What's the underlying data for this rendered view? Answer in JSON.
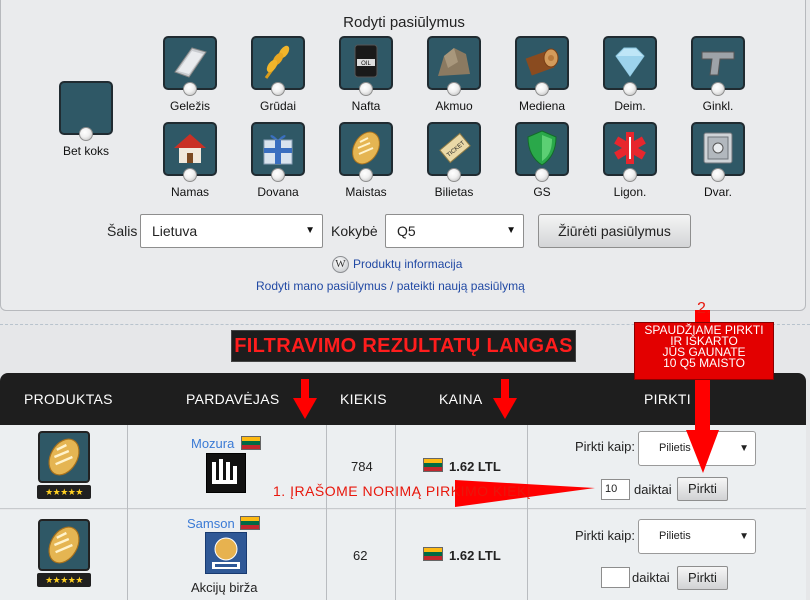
{
  "filter": {
    "title": "Rodyti pasiūlymus",
    "any_label": "Bet koks",
    "products": [
      {
        "label": "Geležis",
        "icon": "iron-bar-icon"
      },
      {
        "label": "Grūdai",
        "icon": "grain-icon"
      },
      {
        "label": "Nafta",
        "icon": "oil-barrel-icon"
      },
      {
        "label": "Akmuo",
        "icon": "stone-icon"
      },
      {
        "label": "Mediena",
        "icon": "wood-log-icon"
      },
      {
        "label": "Deim.",
        "icon": "diamond-icon"
      },
      {
        "label": "Ginkl.",
        "icon": "pistol-icon"
      },
      {
        "label": "Namas",
        "icon": "house-icon"
      },
      {
        "label": "Dovana",
        "icon": "gift-icon"
      },
      {
        "label": "Maistas",
        "icon": "bread-icon"
      },
      {
        "label": "Bilietas",
        "icon": "ticket-icon"
      },
      {
        "label": "GS",
        "icon": "shield-icon"
      },
      {
        "label": "Ligon.",
        "icon": "medical-cross-icon"
      },
      {
        "label": "Dvar.",
        "icon": "safe-icon"
      }
    ],
    "country_label": "Šalis",
    "country_value": "Lietuva",
    "quality_label": "Kokybė",
    "quality_value": "Q5",
    "view_button": "Žiūrėti pasiūlymus",
    "info_link": "Produktų informacija",
    "my_offers_link": "Rodyti mano pasiūlymus / pateikti naują pasiūlymą"
  },
  "results_banner": "FILTRAVIMO REZULTATŲ LANGAS",
  "table": {
    "headers": {
      "product": "PRODUKTAS",
      "seller": "PARDAVĖJAS",
      "amount": "KIEKIS",
      "price": "KAINA",
      "buy": "PIRKTI"
    },
    "buy_as_label": "Pirkti kaip:",
    "units_label": "daiktai",
    "buy_button": "Pirkti",
    "rows": [
      {
        "seller": "Mozura",
        "amount": "784",
        "price": "1.62 LTL",
        "buy_as": "Pilietis",
        "qty": "10",
        "stars": "★★★★★",
        "seller_type": "",
        "quality": 5
      },
      {
        "seller": "Samson",
        "amount": "62",
        "price": "1.62 LTL",
        "buy_as": "Pilietis",
        "qty": "",
        "stars": "★★★★★",
        "seller_type": "Akcijų birža",
        "quality": 5
      }
    ]
  },
  "annotations": {
    "step1": "1. ĮRAŠOME NORIMĄ PIRKIMO KIEKĮ",
    "step2_number": "2.",
    "step2_lines": [
      "SPAUDŽIAME PIRKTI",
      "IR IŠKARTO",
      "JŪS GAUNATE",
      "10 Q5 MAISTO"
    ]
  },
  "colors": {
    "accent_red": "#e8170c",
    "header_dark": "#1e1e1e",
    "link_blue": "#2149a4",
    "icon_bg": "#2f5866"
  }
}
